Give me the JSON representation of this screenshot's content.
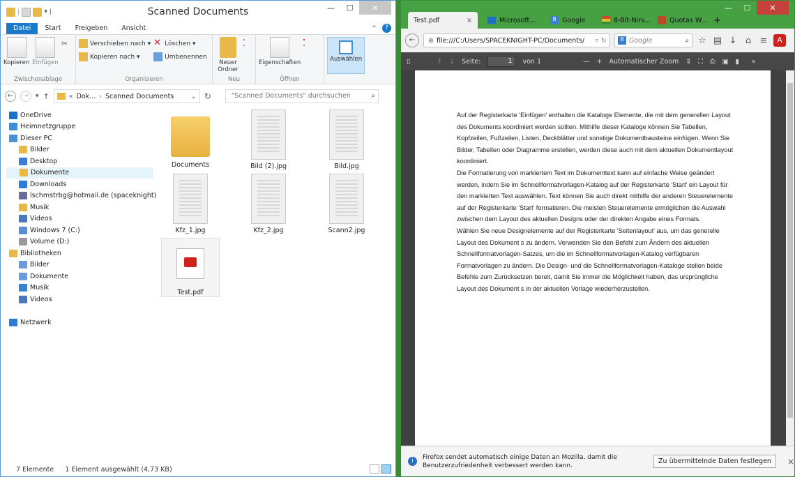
{
  "explorer": {
    "title": "Scanned Documents",
    "tabs": [
      "Datei",
      "Start",
      "Freigeben",
      "Ansicht"
    ],
    "ribbon": {
      "clipboard": {
        "label": "Zwischenablage",
        "copy": "Kopieren",
        "paste": "Einfügen"
      },
      "organize": {
        "label": "Organisieren",
        "move": "Verschieben nach ▾",
        "copyto": "Kopieren nach ▾",
        "delete": "Löschen ▾",
        "rename": "Umbenennen"
      },
      "new": {
        "label": "Neu",
        "folder": "Neuer Ordner"
      },
      "open": {
        "label": "Öffnen",
        "properties": "Eigenschaften"
      },
      "select": {
        "label": "Auswählen"
      }
    },
    "address": {
      "crumb1": "Dok...",
      "crumb2": "Scanned Documents",
      "search_placeholder": "\"Scanned Documents\" durchsuchen"
    },
    "nav": [
      {
        "label": "OneDrive",
        "level": 0,
        "color": "#1e6fc8"
      },
      {
        "label": "Heimnetzgruppe",
        "level": 0,
        "color": "#3b8dd6"
      },
      {
        "label": "Dieser PC",
        "level": 0,
        "color": "#4a90d9"
      },
      {
        "label": "Bilder",
        "level": 1,
        "color": "#e8b848"
      },
      {
        "label": "Desktop",
        "level": 1,
        "color": "#3a7fd0"
      },
      {
        "label": "Dokumente",
        "level": 1,
        "color": "#e8b848",
        "selected": true
      },
      {
        "label": "Downloads",
        "level": 1,
        "color": "#2e7cd6"
      },
      {
        "label": "lschmstrbg@hotmail.de (spaceknight)",
        "level": 1,
        "color": "#6a6a9a"
      },
      {
        "label": "Musik",
        "level": 1,
        "color": "#e8b848"
      },
      {
        "label": "Videos",
        "level": 1,
        "color": "#4a78b8"
      },
      {
        "label": "Windows 7 (C:)",
        "level": 1,
        "color": "#5a8fd0"
      },
      {
        "label": "Volume (D:)",
        "level": 1,
        "color": "#999999"
      },
      {
        "label": "Bibliotheken",
        "level": 0,
        "color": "#e8b848"
      },
      {
        "label": "Bilder",
        "level": 1,
        "color": "#6a9bd8"
      },
      {
        "label": "Dokumente",
        "level": 1,
        "color": "#6a9bd8"
      },
      {
        "label": "Musik",
        "level": 1,
        "color": "#3a7fd0"
      },
      {
        "label": "Videos",
        "level": 1,
        "color": "#4a78b8"
      },
      {
        "label": "",
        "level": 0,
        "color": "transparent"
      },
      {
        "label": "Netzwerk",
        "level": 0,
        "color": "#2e7cd6"
      }
    ],
    "files": [
      {
        "name": "Documents",
        "kind": "folder"
      },
      {
        "name": "Bild (2).jpg",
        "kind": "image"
      },
      {
        "name": "Bild.jpg",
        "kind": "image"
      },
      {
        "name": "Kfz_1.jpg",
        "kind": "image"
      },
      {
        "name": "Kfz_2.jpg",
        "kind": "image"
      },
      {
        "name": "Scann2.jpg",
        "kind": "image"
      },
      {
        "name": "Test.pdf",
        "kind": "pdf",
        "selected": true
      }
    ],
    "status": {
      "count": "7 Elemente",
      "selection": "1 Element ausgewählt (4,73 KB)"
    }
  },
  "firefox": {
    "tabs": [
      {
        "label": "Test.pdf",
        "active": true
      },
      {
        "label": "Microsoft...",
        "color": "#1e6fc8"
      },
      {
        "label": "Google",
        "color": "#3a7fd0"
      },
      {
        "label": "8-Bit-Nirv...",
        "color": "#d04a2a"
      },
      {
        "label": "Quotas W...",
        "color": "#b84a2a"
      }
    ],
    "new_tab": "+",
    "url": "file:///C:/Users/SPACEKNIGHT-PC/Documents/",
    "search_placeholder": "Google",
    "pdf": {
      "page_label": "Seite:",
      "page_value": "1",
      "page_total": "von 1",
      "zoom": "Automatischer Zoom",
      "paragraphs": [
        "Auf der Registerkarte 'Einfügen' enthalten die Kataloge Elemente, die mit dem generellen Layout des Dokuments koordiniert werden sollten. Mithilfe dieser Kataloge können Sie Tabellen, Kopfzeilen, Fußzeilen, Listen, Deckblätter und sonstige Dokumentbausteine einfügen. Wenn Sie Bilder, Tabellen oder Diagramme erstellen, werden diese auch mit dem aktuellen Dokumentlayout koordiniert.",
        "Die Formatierung von markiertem Text im Dokumenttext kann auf einfache Weise geändert werden, indem Sie im Schnellformatvorlagen-Katalog auf der Registerkarte 'Start' ein Layout für den markierten Text auswählen. Text können Sie auch direkt mithilfe der anderen Steuerelemente auf der Registerkarte 'Start' formatieren. Die meisten Steuerelemente ermöglichen die Auswahl zwischen dem Layout des aktuellen Designs oder der direkten Angabe eines Formats.",
        "Wählen Sie neue Designelemente auf der Registerkarte 'Seitenlayout' aus, um das generelle Layout des Dokument s zu ändern. Verwenden Sie den Befehl zum Ändern des aktuellen Schnellformatvorlagen-Satzes, um die im Schnellformatvorlagen-Katalog verfügbaren Formatvorlagen zu ändern. Die Design- und die Schnellformatvorlagen-Kataloge stellen beide Befehle zum Zurücksetzen bereit, damit Sie immer die Möglichkeit haben, das ursprüngliche Layout des Dokument s in der aktuellen Vorlage wiederherzustellen."
      ]
    },
    "notification": {
      "text": "Firefox sendet automatisch einige Daten an Mozilla, damit die Benutzerzufriedenheit verbessert werden kann.",
      "button": "Zu übermittelnde Daten festlegen",
      "close": "×"
    }
  }
}
